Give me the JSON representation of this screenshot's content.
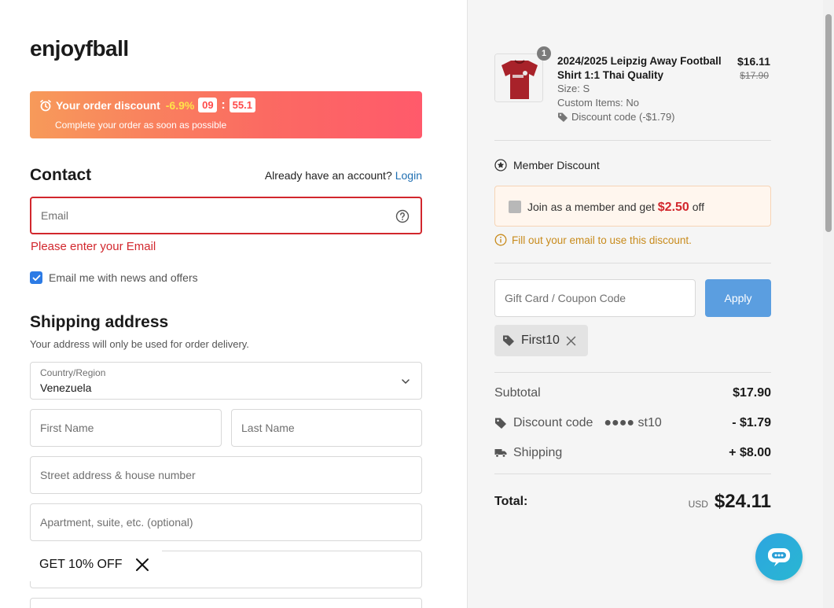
{
  "brand": "enjoyfball",
  "discount_banner": {
    "title": "Your order discount",
    "percent": "-6.9%",
    "minutes": "09",
    "separator": ":",
    "seconds": "55.1",
    "subtitle": "Complete your order as soon as possible"
  },
  "contact": {
    "heading": "Contact",
    "account_prompt": "Already have an account?",
    "login_label": "Login",
    "email_placeholder": "Email",
    "email_error": "Please enter your Email",
    "newsletter_label": "Email me with news and offers",
    "newsletter_checked": true
  },
  "shipping": {
    "heading": "Shipping address",
    "subtitle": "Your address will only be used for order delivery.",
    "country_label": "Country/Region",
    "country_value": "Venezuela",
    "first_name_placeholder": "First Name",
    "last_name_placeholder": "Last Name",
    "street_placeholder": "Street address & house number",
    "apartment_placeholder": "Apartment, suite, etc. (optional)"
  },
  "promo_popup": {
    "label": "GET 10% OFF"
  },
  "order": {
    "item": {
      "quantity": "1",
      "name": "2024/2025 Leipzig Away Football Shirt 1:1 Thai Quality",
      "size": "Size: S",
      "custom": "Custom Items: No",
      "discount": "Discount code (-$1.79)",
      "price": "$16.11",
      "original_price": "$17.90"
    },
    "member": {
      "label": "Member Discount",
      "offer_prefix": "Join as a member and get",
      "offer_amount": "$2.50",
      "offer_suffix": "off",
      "notice": "Fill out your email to use this discount."
    },
    "coupon": {
      "placeholder": "Gift Card / Coupon Code",
      "apply_label": "Apply",
      "applied_code": "First10"
    },
    "summary": {
      "subtotal_label": "Subtotal",
      "subtotal_value": "$17.90",
      "discount_label": "Discount code",
      "discount_code_masked": "●●●● st10",
      "discount_value": "- $1.79",
      "shipping_label": "Shipping",
      "shipping_value": "+ $8.00",
      "total_label": "Total:",
      "currency": "USD",
      "total_value": "$24.11"
    }
  },
  "colors": {
    "accent_blue": "#5b9ee0",
    "error_red": "#d2272d",
    "notice_amber": "#c88b1c",
    "chat_teal": "#2ab7d2"
  }
}
